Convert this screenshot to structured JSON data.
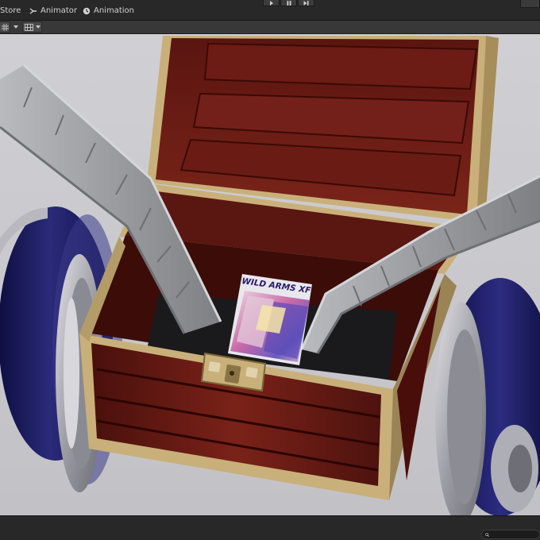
{
  "window": {
    "tabs": [
      {
        "label": "Store",
        "icon": "store-icon"
      },
      {
        "label": "Animator",
        "icon": "animator-icon"
      },
      {
        "label": "Animation",
        "icon": "animation-clock-icon"
      }
    ]
  },
  "playbar": {
    "buttons": [
      "play-icon",
      "pause-icon",
      "step-icon"
    ]
  },
  "toolbar": {
    "buttons": [
      "grid-toggle-icon",
      "dropdown-arrow-icon",
      "scene-tools-icon"
    ]
  },
  "scene": {
    "box_cover": {
      "title": "WILD ARMS XF"
    },
    "colors": {
      "background": "#c9c9cd",
      "wood": "#6e1c14",
      "trim": "#c9b07a",
      "wheel": "#1c1c5c",
      "rim": "#a8a8ae",
      "arm": "#9a9ca0"
    }
  },
  "search": {
    "placeholder": "",
    "value": ""
  }
}
